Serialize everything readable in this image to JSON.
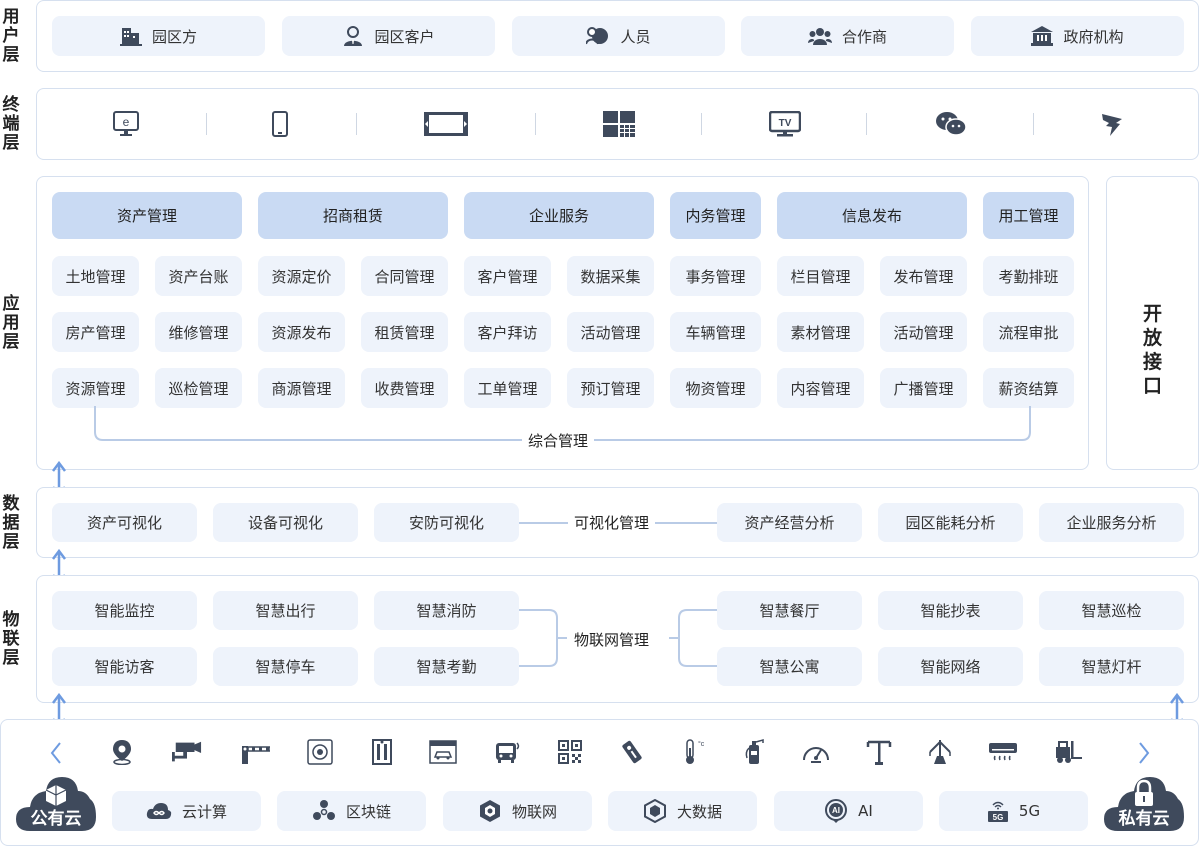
{
  "layers": {
    "user": "用户层",
    "terminal": "终端层",
    "app": "应用层",
    "data": "数据层",
    "iot": "物联层"
  },
  "user_layer": [
    "园区方",
    "园区客户",
    "人员",
    "合作商",
    "政府机构"
  ],
  "terminal_icons": [
    "pc-icon",
    "mobile-icon",
    "screen-icon",
    "video-wall-icon",
    "tv-icon",
    "wechat-icon",
    "dingtalk-icon"
  ],
  "app_layer": {
    "heads": [
      "资产管理",
      "招商租赁",
      "企业服务",
      "内务管理",
      "信息发布",
      "用工管理"
    ],
    "rows": [
      [
        "土地管理",
        "资产台账",
        "资源定价",
        "合同管理",
        "客户管理",
        "数据采集",
        "事务管理",
        "栏目管理",
        "发布管理",
        "考勤排班"
      ],
      [
        "房产管理",
        "维修管理",
        "资源发布",
        "租赁管理",
        "客户拜访",
        "活动管理",
        "车辆管理",
        "素材管理",
        "活动管理",
        "流程审批"
      ],
      [
        "资源管理",
        "巡检管理",
        "商源管理",
        "收费管理",
        "工单管理",
        "预订管理",
        "物资管理",
        "内容管理",
        "广播管理",
        "薪资结算"
      ]
    ],
    "footer": "综合管理",
    "open_api": "开放接口"
  },
  "data_layer": {
    "left": [
      "资产可视化",
      "设备可视化",
      "安防可视化"
    ],
    "center": "可视化管理",
    "right": [
      "资产经营分析",
      "园区能耗分析",
      "企业服务分析"
    ]
  },
  "iot_layer": {
    "left": [
      [
        "智能监控",
        "智慧出行",
        "智慧消防"
      ],
      [
        "智能访客",
        "智慧停车",
        "智慧考勤"
      ]
    ],
    "center": "物联网管理",
    "right": [
      [
        "智慧餐厅",
        "智能抄表",
        "智慧巡检"
      ],
      [
        "智慧公寓",
        "智能网络",
        "智慧灯杆"
      ]
    ]
  },
  "infra": {
    "public_cloud": "公有云",
    "private_cloud": "私有云",
    "services": [
      "云计算",
      "区块链",
      "物联网",
      "大数据",
      "AI",
      "5G"
    ],
    "service_icons": [
      "cloud-icon",
      "blockchain-icon",
      "iot-icon",
      "bigdata-icon",
      "ai-icon",
      "5g-icon"
    ],
    "device_icons": [
      "location-icon",
      "camera-icon",
      "barrier-gate-icon",
      "face-scan-icon",
      "access-gate-icon",
      "parking-screen-icon",
      "bus-icon",
      "qr-code-icon",
      "smart-lock-icon",
      "thermometer-icon",
      "fire-extinguisher-icon",
      "meter-gauge-icon",
      "street-lamp-icon",
      "tower-crane-icon",
      "air-conditioner-icon",
      "forklift-icon"
    ]
  },
  "colors": {
    "chip": "#eef3fb",
    "head": "#c9daf3",
    "border": "#d6e0ef",
    "icon": "#3f4a5c",
    "arrow": "#6e9be0",
    "cloud": "#3f4a5c"
  }
}
